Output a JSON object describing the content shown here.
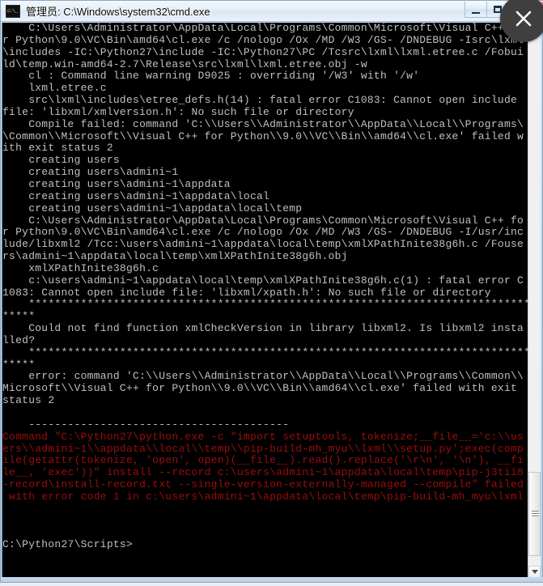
{
  "window": {
    "title": "管理员: C:\\Windows\\system32\\cmd.exe",
    "icon": "cmd-icon",
    "controls": {
      "minimize_label": "–",
      "maximize_label": "❐",
      "close_label": "✕"
    }
  },
  "overlay": {
    "badge_icon": "close-x-icon",
    "badge_color": "#3f3f3f"
  },
  "scrollbar": {
    "up_arrow": "scroll-up-icon",
    "down_arrow": "scroll-down-icon",
    "thumb_position_percent": 84
  },
  "colors": {
    "console_background": "#000000",
    "console_foreground": "#c0c0c0",
    "error_foreground": "#9d0d0d",
    "titlebar_text": "#0a0a0a"
  },
  "console": {
    "prompt": "C:\\Python27\\Scripts>",
    "lines": [
      {
        "text": "    C:\\Users\\Administrator\\AppData\\Local\\Programs\\Common\\Microsoft\\Visual C++ fo",
        "color": "normal"
      },
      {
        "text": "r Python\\9.0\\VC\\Bin\\amd64\\cl.exe /c /nologo /Ox /MD /W3 /GS- /DNDEBUG -Isrc\\lxml",
        "color": "normal"
      },
      {
        "text": "\\includes -IC:\\Python27\\include -IC:\\Python27\\PC /Tcsrc\\lxml\\lxml.etree.c /Fobui",
        "color": "normal"
      },
      {
        "text": "ld\\temp.win-amd64-2.7\\Release\\src\\lxml\\lxml.etree.obj -w",
        "color": "normal"
      },
      {
        "text": "    cl : Command line warning D9025 : overriding '/W3' with '/w'",
        "color": "normal"
      },
      {
        "text": "    lxml.etree.c",
        "color": "normal"
      },
      {
        "text": "    src\\lxml\\includes\\etree_defs.h(14) : fatal error C1083: Cannot open include",
        "color": "normal"
      },
      {
        "text": "file: 'libxml/xmlversion.h': No such file or directory",
        "color": "normal"
      },
      {
        "text": "    Compile failed: command 'C:\\\\Users\\\\Administrator\\\\AppData\\\\Local\\\\Programs\\",
        "color": "normal"
      },
      {
        "text": "\\Common\\\\Microsoft\\\\Visual C++ for Python\\\\9.0\\\\VC\\\\Bin\\\\amd64\\\\cl.exe' failed w",
        "color": "normal"
      },
      {
        "text": "ith exit status 2",
        "color": "normal"
      },
      {
        "text": "    creating users",
        "color": "normal"
      },
      {
        "text": "    creating users\\admini~1",
        "color": "normal"
      },
      {
        "text": "    creating users\\admini~1\\appdata",
        "color": "normal"
      },
      {
        "text": "    creating users\\admini~1\\appdata\\local",
        "color": "normal"
      },
      {
        "text": "    creating users\\admini~1\\appdata\\local\\temp",
        "color": "normal"
      },
      {
        "text": "    C:\\Users\\Administrator\\AppData\\Local\\Programs\\Common\\Microsoft\\Visual C++ fo",
        "color": "normal"
      },
      {
        "text": "r Python\\9.0\\VC\\Bin\\amd64\\cl.exe /c /nologo /Ox /MD /W3 /GS- /DNDEBUG -I/usr/inc",
        "color": "normal"
      },
      {
        "text": "lude/libxml2 /Tcc:\\users\\admini~1\\appdata\\local\\temp\\xmlXPathInite38g6h.c /Fouse",
        "color": "normal"
      },
      {
        "text": "rs\\admini~1\\appdata\\local\\temp\\xmlXPathInite38g6h.obj",
        "color": "normal"
      },
      {
        "text": "    xmlXPathInite38g6h.c",
        "color": "normal"
      },
      {
        "text": "    c:\\users\\admini~1\\appdata\\local\\temp\\xmlXPathInite38g6h.c(1) : fatal error C",
        "color": "normal"
      },
      {
        "text": "1083: Cannot open include file: 'libxml/xpath.h': No such file or directory",
        "color": "normal"
      },
      {
        "text": "    *******************************************************************************",
        "color": "normal"
      },
      {
        "text": "*****",
        "color": "normal"
      },
      {
        "text": "    Could not find function xmlCheckVersion in library libxml2. Is libxml2 insta",
        "color": "normal"
      },
      {
        "text": "lled?",
        "color": "normal"
      },
      {
        "text": "    *******************************************************************************",
        "color": "normal"
      },
      {
        "text": "*****",
        "color": "normal"
      },
      {
        "text": "    error: command 'C:\\\\Users\\\\Administrator\\\\AppData\\\\Local\\\\Programs\\\\Common\\\\",
        "color": "normal"
      },
      {
        "text": "Microsoft\\\\Visual C++ for Python\\\\9.0\\\\VC\\\\Bin\\\\amd64\\\\cl.exe' failed with exit",
        "color": "normal"
      },
      {
        "text": "status 2",
        "color": "normal"
      },
      {
        "text": "",
        "color": "normal"
      },
      {
        "text": "    ----------------------------------------",
        "color": "normal"
      },
      {
        "text": "Command \"C:\\Python27\\python.exe -c \"import setuptools, tokenize;__file__='c:\\\\us",
        "color": "red"
      },
      {
        "text": "ers\\\\admini~1\\\\appdata\\\\local\\\\temp\\\\pip-build-mh_myu\\\\lxml\\\\setup.py';exec(comp",
        "color": "red"
      },
      {
        "text": "ile(getattr(tokenize, 'open', open)(__file__).read().replace('\\r\\n', '\\n'), __fi",
        "color": "red"
      },
      {
        "text": "le__, 'exec'))\" install --record c:\\users\\admini~1\\appdata\\local\\temp\\pip-j3tii8",
        "color": "red"
      },
      {
        "text": "-record\\install-record.txt --single-version-externally-managed --compile\" failed",
        "color": "red"
      },
      {
        "text": " with error code 1 in c:\\users\\admini~1\\appdata\\local\\temp\\pip-build-mh_myu\\lxml",
        "color": "red"
      },
      {
        "text": "",
        "color": "normal"
      },
      {
        "text": "",
        "color": "normal"
      },
      {
        "text": "",
        "color": "normal"
      },
      {
        "text": "C:\\Python27\\Scripts>",
        "color": "normal"
      }
    ]
  }
}
